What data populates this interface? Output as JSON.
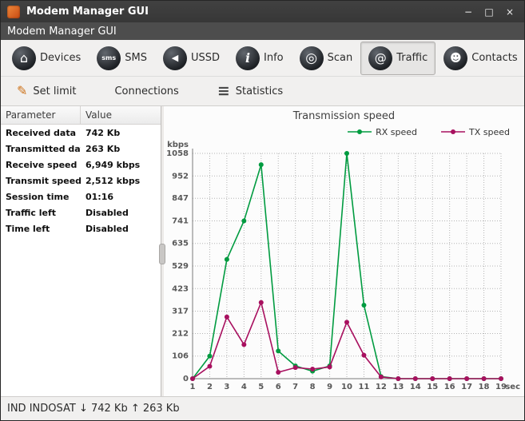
{
  "window": {
    "title": "Modem Manager GUI",
    "controls": {
      "minimize": "−",
      "maximize": "□",
      "close": "×"
    }
  },
  "headerbar": {
    "title": "Modem Manager GUI"
  },
  "toolbar": {
    "items": [
      {
        "id": "devices",
        "label": "Devices",
        "glyph": "⌂",
        "active": false
      },
      {
        "id": "sms",
        "label": "SMS",
        "glyph": "sms",
        "active": false
      },
      {
        "id": "ussd",
        "label": "USSD",
        "glyph": "◀",
        "active": false
      },
      {
        "id": "info",
        "label": "Info",
        "glyph": "i",
        "active": false
      },
      {
        "id": "scan",
        "label": "Scan",
        "glyph": "◎",
        "active": false
      },
      {
        "id": "traffic",
        "label": "Traffic",
        "glyph": "@",
        "active": true
      },
      {
        "id": "contacts",
        "label": "Contacts",
        "glyph": "☻",
        "active": false
      }
    ]
  },
  "subtoolbar": {
    "items": [
      {
        "id": "set-limit",
        "label": "Set limit",
        "icon_glyph": "✎",
        "icon_name": "pencil-icon",
        "icon_class": "icon-pencil"
      },
      {
        "id": "connections",
        "label": "Connections",
        "icon_glyph": "",
        "icon_name": "",
        "icon_class": ""
      },
      {
        "id": "statistics",
        "label": "Statistics",
        "icon_glyph": "≡",
        "icon_name": "menu-icon",
        "icon_class": "icon-menu"
      }
    ]
  },
  "stats": {
    "columns": [
      "Parameter",
      "Value"
    ],
    "rows": [
      {
        "parameter": "Received data",
        "value": "742 Kb"
      },
      {
        "parameter": "Transmitted data",
        "value": "263 Kb"
      },
      {
        "parameter": "Receive speed",
        "value": "6,949 kbps"
      },
      {
        "parameter": "Transmit speed",
        "value": "2,512 kbps"
      },
      {
        "parameter": "Session time",
        "value": "01:16"
      },
      {
        "parameter": "Traffic left",
        "value": "Disabled"
      },
      {
        "parameter": "Time left",
        "value": "Disabled"
      }
    ]
  },
  "chart_data": {
    "type": "line",
    "title": "Transmission speed",
    "ylabel": "kbps",
    "xlabel": "sec",
    "x": [
      1,
      2,
      3,
      4,
      5,
      6,
      7,
      8,
      9,
      10,
      11,
      12,
      13,
      14,
      15,
      16,
      17,
      18,
      19
    ],
    "yticks": [
      0,
      106,
      212,
      317,
      423,
      529,
      635,
      741,
      847,
      952,
      1058
    ],
    "ylim": [
      0,
      1058
    ],
    "grid": true,
    "legend_position": "top-right",
    "series": [
      {
        "name": "RX speed",
        "color": "#009b40",
        "values": [
          0,
          106,
          560,
          741,
          1005,
          130,
          60,
          35,
          60,
          1058,
          345,
          10,
          0,
          0,
          0,
          0,
          0,
          0,
          0
        ]
      },
      {
        "name": "TX speed",
        "color": "#a8105f",
        "values": [
          0,
          58,
          290,
          160,
          358,
          30,
          52,
          45,
          55,
          265,
          110,
          8,
          0,
          0,
          0,
          0,
          0,
          0,
          0
        ]
      }
    ]
  },
  "statusbar": {
    "text": "IND INDOSAT ↓ 742 Kb ↑ 263 Kb"
  },
  "colors": {
    "rx_green": "#009b40",
    "tx_magenta": "#a8105f",
    "accent_orange": "#d8671f"
  }
}
